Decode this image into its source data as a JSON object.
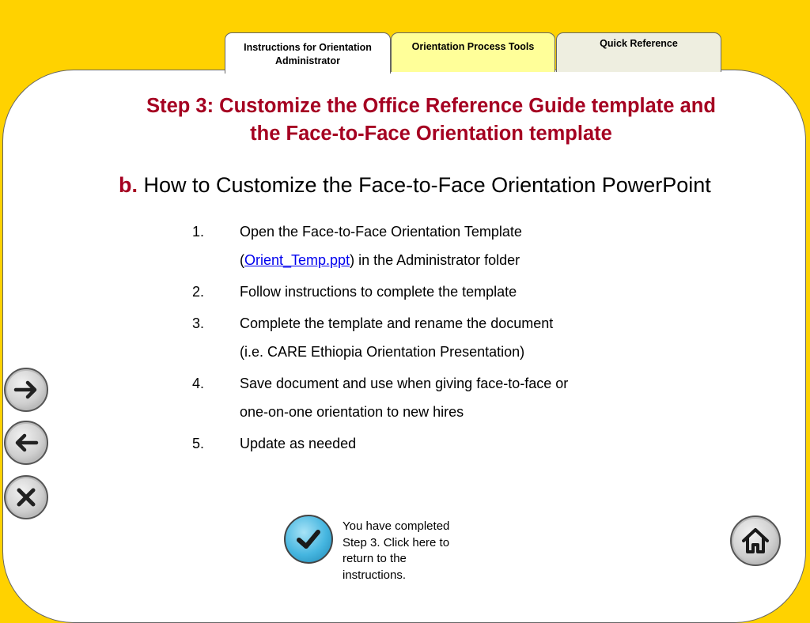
{
  "tabs": [
    {
      "line1": "Instructions for  Orientation",
      "line2": "Administrator"
    },
    {
      "label": "Orientation Process Tools"
    },
    {
      "label": "Quick Reference"
    }
  ],
  "title": {
    "line1": "Step 3: Customize the Office Reference Guide template and",
    "line2": "the Face-to-Face Orientation template"
  },
  "subtitle": {
    "letter": "b.",
    "text": " How to Customize the Face-to-Face Orientation PowerPoint"
  },
  "steps": [
    {
      "num": "1.",
      "line1": "Open the Face-to-Face Orientation Template",
      "pre_link": "(",
      "link": "Orient_Temp.ppt",
      "post_link": ") in the Administrator folder"
    },
    {
      "num": "2.",
      "line1": "Follow instructions to complete the template"
    },
    {
      "num": "3.",
      "line1": "Complete the template and rename the document",
      "line2": "(i.e. CARE Ethiopia Orientation Presentation)"
    },
    {
      "num": "4.",
      "line1": "Save document  and use when giving face-to-face or",
      "line2": "one-on-one orientation to new hires"
    },
    {
      "num": "5.",
      "line1": "Update as needed"
    }
  ],
  "completion": {
    "line1": "You have completed",
    "line2": "Step 3. Click here to",
    "line3": "return to the",
    "line4": "instructions."
  },
  "icons": {
    "forward": "arrow-right-icon",
    "back": "arrow-left-icon",
    "close": "close-icon",
    "check": "checkmark-icon",
    "home": "home-icon"
  },
  "colors": {
    "background": "#FFD200",
    "title": "#A50021",
    "tab_active": "#FFFFFF",
    "tab_tools": "#FFFF99",
    "tab_reference": "#EEEEE0",
    "link": "#0000EE",
    "check_button": "#46B6E0"
  }
}
